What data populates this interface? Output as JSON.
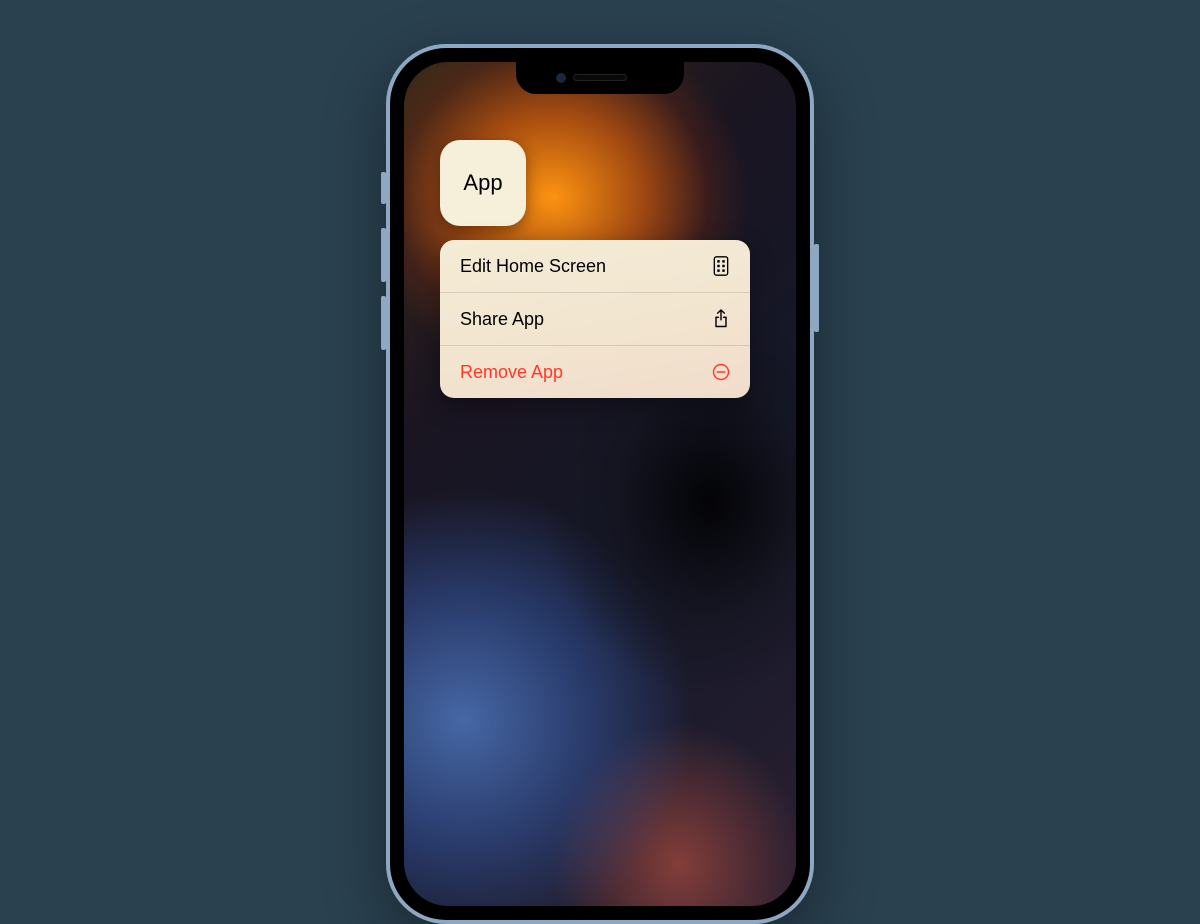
{
  "app_icon": {
    "label": "App"
  },
  "context_menu": {
    "items": [
      {
        "label": "Edit Home Screen",
        "icon": "apps-icon",
        "destructive": false
      },
      {
        "label": "Share App",
        "icon": "share-icon",
        "destructive": false
      },
      {
        "label": "Remove App",
        "icon": "minus-circle-icon",
        "destructive": true
      }
    ]
  },
  "colors": {
    "background": "#2a4150",
    "destructive": "#ff3b30",
    "menu_bg": "#f3ecd8"
  }
}
